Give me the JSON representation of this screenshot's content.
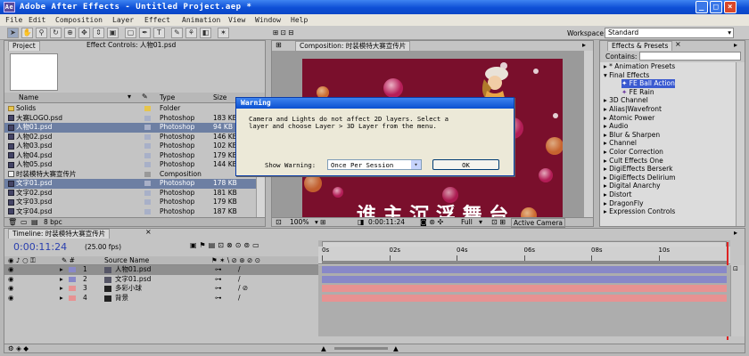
{
  "window": {
    "title": "Adobe After Effects - Untitled Project.aep *"
  },
  "menu": [
    "File",
    "Edit",
    "Composition",
    "Layer",
    "Effect",
    "Animation",
    "View",
    "Window",
    "Help"
  ],
  "toolbar": {
    "workspace_label": "Workspace:",
    "workspace_value": "Standard"
  },
  "project": {
    "tabs": [
      "Project",
      "Effect Controls: 人物01.psd"
    ],
    "columns": [
      "Name",
      "Type",
      "Size"
    ],
    "items": [
      {
        "name": "Solids",
        "type": "Folder",
        "size": "",
        "icon": "folder",
        "selected": false
      },
      {
        "name": "大赛LOGO.psd",
        "type": "Photoshop",
        "size": "183 KB",
        "icon": "psd",
        "selected": false
      },
      {
        "name": "人物01.psd",
        "type": "Photoshop",
        "size": "94 KB",
        "icon": "psd",
        "selected": true
      },
      {
        "name": "人物02.psd",
        "type": "Photoshop",
        "size": "146 KB",
        "icon": "psd",
        "selected": false
      },
      {
        "name": "人物03.psd",
        "type": "Photoshop",
        "size": "102 KB",
        "icon": "psd",
        "selected": false
      },
      {
        "name": "人物04.psd",
        "type": "Photoshop",
        "size": "179 KB",
        "icon": "psd",
        "selected": false
      },
      {
        "name": "人物05.psd",
        "type": "Photoshop",
        "size": "144 KB",
        "icon": "psd",
        "selected": false
      },
      {
        "name": "时装模特大赛宣传片",
        "type": "Composition",
        "size": "",
        "icon": "comp",
        "selected": false
      },
      {
        "name": "文字01.psd",
        "type": "Photoshop",
        "size": "178 KB",
        "icon": "psd",
        "selected": true
      },
      {
        "name": "文字02.psd",
        "type": "Photoshop",
        "size": "181 KB",
        "icon": "psd",
        "selected": false
      },
      {
        "name": "文字03.psd",
        "type": "Photoshop",
        "size": "179 KB",
        "icon": "psd",
        "selected": false
      },
      {
        "name": "文字04.psd",
        "type": "Photoshop",
        "size": "187 KB",
        "icon": "psd",
        "selected": false
      }
    ],
    "bpc": "8 bpc"
  },
  "composition": {
    "tab": "Composition: 时装模特大赛宣传片",
    "zoom": "100%",
    "timecode": "0:00:11:24",
    "resolution": "Full",
    "camera": "Active Camera",
    "banner_text": "谁 主 沉 浮 舞 台"
  },
  "effects": {
    "tab": "Effects & Presets",
    "contains_label": "Contains:",
    "items": [
      {
        "label": "* Animation Presets",
        "indent": 0,
        "exp": "▸",
        "selected": false
      },
      {
        "label": "Final Effects",
        "indent": 0,
        "exp": "▾",
        "selected": false
      },
      {
        "label": "FE Ball Action",
        "indent": 2,
        "exp": "",
        "selected": true
      },
      {
        "label": "FE Rain",
        "indent": 2,
        "exp": "",
        "selected": false
      },
      {
        "label": "3D Channel",
        "indent": 0,
        "exp": "▸",
        "selected": false
      },
      {
        "label": "Alias|Wavefront",
        "indent": 0,
        "exp": "▸",
        "selected": false
      },
      {
        "label": "Atomic Power",
        "indent": 0,
        "exp": "▸",
        "selected": false
      },
      {
        "label": "Audio",
        "indent": 0,
        "exp": "▸",
        "selected": false
      },
      {
        "label": "Blur & Sharpen",
        "indent": 0,
        "exp": "▸",
        "selected": false
      },
      {
        "label": "Channel",
        "indent": 0,
        "exp": "▸",
        "selected": false
      },
      {
        "label": "Color Correction",
        "indent": 0,
        "exp": "▸",
        "selected": false
      },
      {
        "label": "Cult Effects One",
        "indent": 0,
        "exp": "▸",
        "selected": false
      },
      {
        "label": "DigiEffects Berserk",
        "indent": 0,
        "exp": "▸",
        "selected": false
      },
      {
        "label": "DigiEffects Delirium",
        "indent": 0,
        "exp": "▸",
        "selected": false
      },
      {
        "label": "Digital Anarchy",
        "indent": 0,
        "exp": "▸",
        "selected": false
      },
      {
        "label": "Distort",
        "indent": 0,
        "exp": "▸",
        "selected": false
      },
      {
        "label": "DragonFly",
        "indent": 0,
        "exp": "▸",
        "selected": false
      },
      {
        "label": "Expression Controls",
        "indent": 0,
        "exp": "▸",
        "selected": false
      }
    ]
  },
  "dialog": {
    "title": "Warning",
    "message_line1": "Camera and Lights do not affect 2D layers.  Select a",
    "message_line2": "layer and choose Layer > 3D Layer from the menu.",
    "show_label": "Show Warning:",
    "show_value": "Once Per Session",
    "ok": "OK"
  },
  "timeline": {
    "tab": "Timeline: 时装模特大赛宣传片",
    "timecode": "0:00:11:24",
    "fps": "(25.00 fps)",
    "source_header": "Source Name",
    "ruler": [
      "0s",
      "02s",
      "04s",
      "06s",
      "08s",
      "10s"
    ],
    "layers": [
      {
        "num": "1",
        "name": "人物01.psd",
        "color": "#8888c8",
        "selected": true
      },
      {
        "num": "2",
        "name": "文字01.psd",
        "color": "#8888c8",
        "selected": false
      },
      {
        "num": "3",
        "name": "多彩小球",
        "color": "#e79292",
        "selected": false
      },
      {
        "num": "4",
        "name": "背景",
        "color": "#e79292",
        "selected": false
      }
    ]
  },
  "colors": {
    "layer_purple": "#8888c8",
    "layer_pink": "#e79292",
    "selection": "#6d7fa3",
    "comp_bg": "#7a0f2c"
  }
}
